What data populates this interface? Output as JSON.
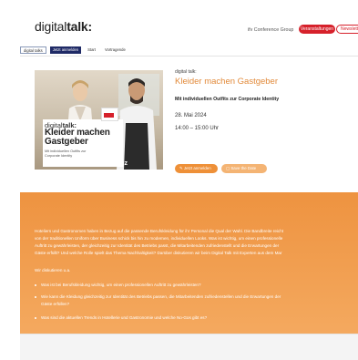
{
  "header": {
    "logo_light": "digital",
    "logo_bold": "talk:",
    "link": "ifv Conference Group",
    "primary_button": "Veranstaltungen",
    "secondary_button": "Newsletter"
  },
  "breadcrumb": [
    "digital talks",
    "Jetzt anmelden",
    "Start",
    "Vortragende"
  ],
  "active_tab": 1,
  "hero": {
    "card_logo_light": "digital",
    "card_logo_bold": "talk:",
    "card_title": "Kleider machen Gastgeber",
    "card_subtitle": "Mit individuellen Outfits zur Corporate Identity",
    "brand": "ahgz"
  },
  "event": {
    "eyebrow": "digital talk:",
    "title": "Kleider machen Gastgeber",
    "subtitle": "Mit individuellen Outfits zur Corporate Identity",
    "date": "28. Mai 2024",
    "time": "14:00 – 15:00 Uhr",
    "register_button": "Jetzt anmelden",
    "save_date_button": "Save the Date"
  },
  "description": {
    "paragraph_lines": [
      "Hoteliers und Gastronomen haben in Bezug auf die passende Berufskleidung für ihr Personal die Qual der Wahl. Die Bandbreite reicht",
      "von der traditionellen Uniform über Business schick bis hin zu modernen, individuellen Looks. Was ist wichtig, um einen professionelle",
      "Auftritt zu gewährleisten, der gleichzeitig zur Identität des Betriebs passt, die Mitarbeitenden zufriedenstellt und die Erwartungen der",
      "Gäste erfüllt? Und welche Rolle spielt das Thema Nachhaltigkeit? Darüber diskutieren wir beim Digital Talk mit Experten aus dem Mar"
    ],
    "intro": "Wir diskutieren u.a.",
    "bullets": [
      "Was ist bei Berufskleidung wichtig, um einen professionellen Auftritt zu gewährleisten?",
      "Wie kann die Kleidung gleichzeitig zur Identität des Betriebs passen, die Mitarbeitenden zufriedenstellen und die Erwartungen der",
      "Gäste erfüllen?",
      "Was sind die aktuellen Trends in Hotellerie und Gastronomie und welche No-Gos gibt es?"
    ]
  },
  "colors": {
    "accent_orange": "#ee9340",
    "brand_red": "#d6212b",
    "nav_blue": "#1f2a66"
  }
}
